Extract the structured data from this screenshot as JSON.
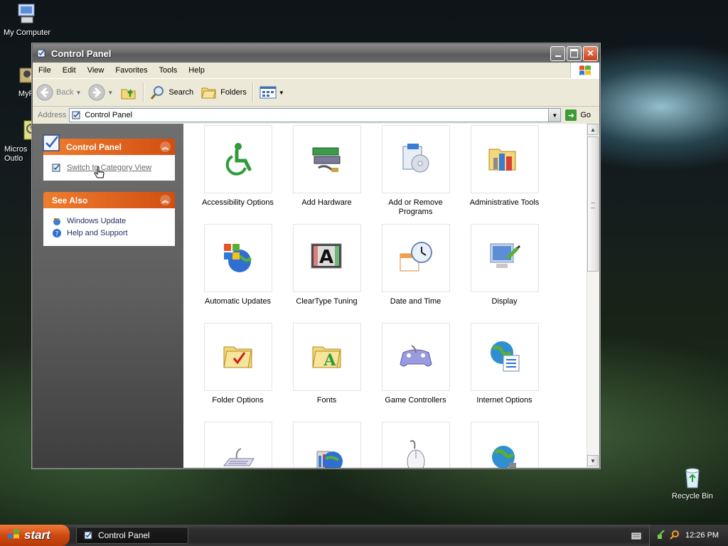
{
  "desktop": {
    "icons": [
      {
        "label": "My Computer"
      },
      {
        "label": "MyPa"
      },
      {
        "label": "Micros Outlo"
      },
      {
        "label": "Recycle Bin"
      }
    ]
  },
  "window": {
    "title": "Control Panel",
    "menu": [
      "File",
      "Edit",
      "View",
      "Favorites",
      "Tools",
      "Help"
    ],
    "toolbar": {
      "back": "Back",
      "search": "Search",
      "folders": "Folders"
    },
    "address": {
      "label": "Address",
      "value": "Control Panel",
      "go": "Go"
    }
  },
  "leftpane": {
    "control_panel": {
      "title": "Control Panel",
      "link": "Switch to Category View"
    },
    "see_also": {
      "title": "See Also",
      "links": [
        "Windows Update",
        "Help and Support"
      ]
    }
  },
  "items": [
    {
      "label": "Accessibility Options",
      "icon": "accessibility-icon"
    },
    {
      "label": "Add Hardware",
      "icon": "add-hardware-icon"
    },
    {
      "label": "Add or Remove Programs",
      "icon": "add-remove-programs-icon"
    },
    {
      "label": "Administrative Tools",
      "icon": "administrative-tools-icon"
    },
    {
      "label": "Automatic Updates",
      "icon": "automatic-updates-icon"
    },
    {
      "label": "ClearType Tuning",
      "icon": "cleartype-icon"
    },
    {
      "label": "Date and Time",
      "icon": "date-time-icon"
    },
    {
      "label": "Display",
      "icon": "display-icon"
    },
    {
      "label": "Folder Options",
      "icon": "folder-options-icon"
    },
    {
      "label": "Fonts",
      "icon": "fonts-icon"
    },
    {
      "label": "Game Controllers",
      "icon": "game-controllers-icon"
    },
    {
      "label": "Internet Options",
      "icon": "internet-options-icon"
    },
    {
      "label": "",
      "icon": "keyboard-icon"
    },
    {
      "label": "",
      "icon": "network-icon"
    },
    {
      "label": "",
      "icon": "mouse-icon"
    },
    {
      "label": "",
      "icon": "network-connections-icon"
    }
  ],
  "taskbar": {
    "start": "start",
    "task": "Control Panel",
    "clock": "12:26 PM"
  }
}
